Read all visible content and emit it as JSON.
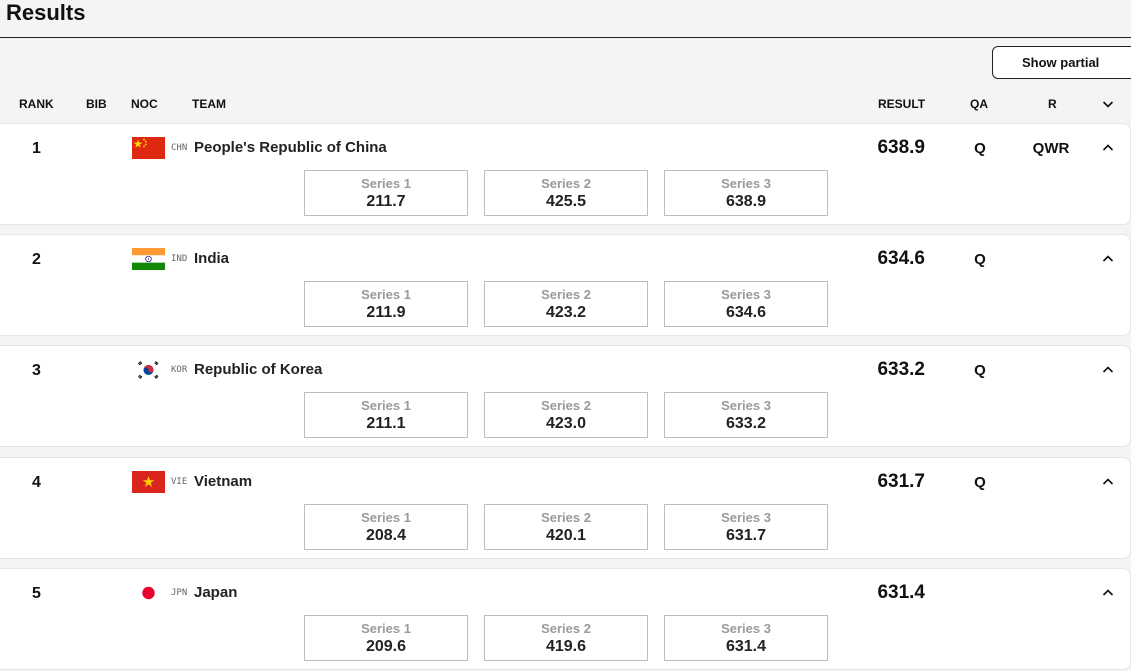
{
  "page": {
    "title": "Results"
  },
  "toolbar": {
    "show_partial_label": "Show partial"
  },
  "columns": {
    "rank": "RANK",
    "bib": "BIB",
    "noc": "NOC",
    "team": "TEAM",
    "result": "RESULT",
    "qa": "QA",
    "r": "R"
  },
  "colors": {
    "background": "#f4f4f4",
    "card": "#ffffff",
    "series_label": "#9a9a9a"
  },
  "rows": [
    {
      "rank": "1",
      "noc": "CHN",
      "team": "People's Republic of China",
      "result": "638.9",
      "qa": "Q",
      "r": "QWR",
      "series": [
        {
          "label": "Series 1",
          "value": "211.7"
        },
        {
          "label": "Series 2",
          "value": "425.5"
        },
        {
          "label": "Series 3",
          "value": "638.9"
        }
      ]
    },
    {
      "rank": "2",
      "noc": "IND",
      "team": "India",
      "result": "634.6",
      "qa": "Q",
      "r": "",
      "series": [
        {
          "label": "Series 1",
          "value": "211.9"
        },
        {
          "label": "Series 2",
          "value": "423.2"
        },
        {
          "label": "Series 3",
          "value": "634.6"
        }
      ]
    },
    {
      "rank": "3",
      "noc": "KOR",
      "team": "Republic of Korea",
      "result": "633.2",
      "qa": "Q",
      "r": "",
      "series": [
        {
          "label": "Series 1",
          "value": "211.1"
        },
        {
          "label": "Series 2",
          "value": "423.0"
        },
        {
          "label": "Series 3",
          "value": "633.2"
        }
      ]
    },
    {
      "rank": "4",
      "noc": "VIE",
      "team": "Vietnam",
      "result": "631.7",
      "qa": "Q",
      "r": "",
      "series": [
        {
          "label": "Series 1",
          "value": "208.4"
        },
        {
          "label": "Series 2",
          "value": "420.1"
        },
        {
          "label": "Series 3",
          "value": "631.7"
        }
      ]
    },
    {
      "rank": "5",
      "noc": "JPN",
      "team": "Japan",
      "result": "631.4",
      "qa": "",
      "r": "",
      "series": [
        {
          "label": "Series 1",
          "value": "209.6"
        },
        {
          "label": "Series 2",
          "value": "419.6"
        },
        {
          "label": "Series 3",
          "value": "631.4"
        }
      ]
    }
  ]
}
